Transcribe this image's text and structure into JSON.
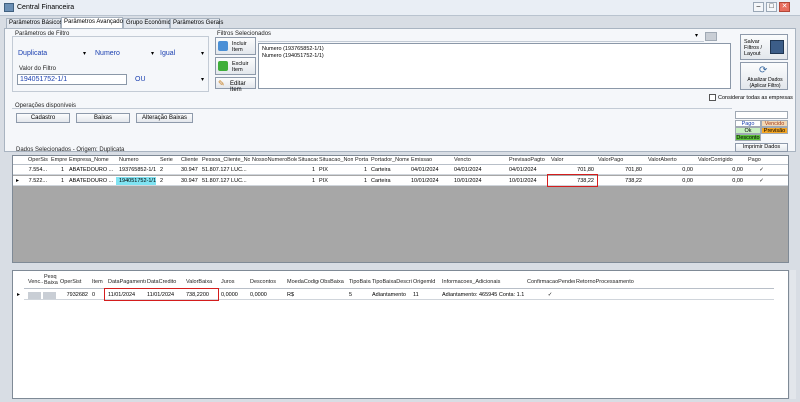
{
  "window": {
    "title": "Central Financeira",
    "min": "–",
    "max": "□",
    "close": "✕"
  },
  "tabs": [
    {
      "label": "Parâmetros Básicos"
    },
    {
      "label": "Parâmetros Avançados"
    },
    {
      "label": "Grupo Econômico"
    },
    {
      "label": "Parâmetros Gerais"
    }
  ],
  "filter_params": {
    "group_label": "Parâmetros de Filtro",
    "field1": "Duplicata",
    "field2": "Numero",
    "field3": "Igual",
    "value_label": "Valor do Filtro",
    "value": "194051752-1/1",
    "logic": "OU"
  },
  "filter_actions": {
    "include": "Incluir Item",
    "exclude": "Excluir Item",
    "edit": "Editar Item"
  },
  "selected_filters": {
    "label": "Filtros Selecionados",
    "items": [
      "Numero (193765852-1/1)",
      "Numero (194051752-1/1)"
    ]
  },
  "right_actions": {
    "save": "Salvar Filtros / Layout",
    "update": "Atualizar Dados (Aplicar Filtro)",
    "consider_companies": "Considerar todas as empresas"
  },
  "ops": {
    "label": "Operações disponíveis",
    "buttons": [
      "Cadastro",
      "Baixas",
      "Alteração Baixas"
    ]
  },
  "legend": {
    "pago": "Pago",
    "vencido": "Vencido",
    "ok": "Ok",
    "previsao": "Previsão",
    "desconto": "Desconto",
    "colors": {
      "pago": "#ffffff",
      "vencido": "#f3d9b5",
      "ok": "#c8f0c0",
      "previsao": "#f5a623",
      "desconto": "#5cc23a"
    }
  },
  "print_label": "Imprimir Dados",
  "main_grid": {
    "caption": "Dados Selecionados - Origem: Duplicata",
    "columns": [
      "OperSis",
      "Empresa",
      "Empresa_Nome",
      "Numero",
      "Serie",
      "Cliente",
      "Pessoa_Cliente_Nome",
      "NossoNumeroBoleto",
      "Situacao",
      "Situacao_Nome",
      "Porta",
      "Portador_Nome",
      "Emissao",
      "Vencto",
      "PrevisaoPagto",
      "Valor",
      "ValorPago",
      "ValorAberto",
      "ValorCorrigido",
      "Pago"
    ],
    "rows": [
      [
        "7.554...",
        "1",
        "ABATEDOURO ...",
        "193765852-1/1",
        "2",
        "30.947",
        "51.807.127 LUC...",
        "",
        "1",
        "PIX",
        "1",
        "Carteira",
        "04/01/2024",
        "04/01/2024",
        "04/01/2024",
        "701,80",
        "701,80",
        "0,00",
        "0,00",
        "✓"
      ],
      [
        "7.522...",
        "1",
        "ABATEDOURO ...",
        "194051752-1/1",
        "2",
        "30.947",
        "51.807.127 LUC...",
        "",
        "1",
        "PIX",
        "1",
        "Carteira",
        "10/01/2024",
        "10/01/2024",
        "10/01/2024",
        "738,22",
        "738,22",
        "0,00",
        "0,00",
        "✓"
      ]
    ]
  },
  "detail_grid": {
    "columns": [
      "Venc...",
      "Pesq Baixa",
      "OperSist",
      "Item",
      "DataPagamento",
      "DataCredito",
      "ValorBaixa",
      "Juros",
      "Descontos",
      "MoedaCodigo",
      "ObsBaixa",
      "TipoBaixa",
      "TipoBaixaDescri",
      "Origemld",
      "Informacoes_Adicionais",
      "ConfirmacaoPendente",
      "RetornoProcessamento"
    ],
    "rows": [
      [
        "",
        "",
        "7932682",
        "0",
        "11/01/2024",
        "11/01/2024",
        "738,2200",
        "0,0000",
        "0,0000",
        "R$",
        "",
        "5",
        "Adiantamento",
        "11",
        "Adiantamento: 465945 Conta: 1.1",
        "✓",
        ""
      ]
    ]
  }
}
